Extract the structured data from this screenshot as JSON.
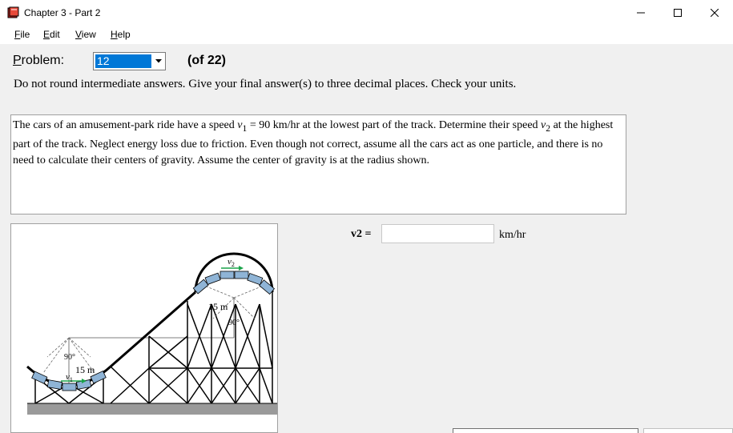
{
  "window": {
    "title": "Chapter 3 - Part 2",
    "controls": [
      "minimize",
      "maximize",
      "close"
    ]
  },
  "menu": {
    "file": {
      "accel": "F",
      "rest": "ile"
    },
    "edit": {
      "accel": "E",
      "rest": "dit"
    },
    "view": {
      "accel": "V",
      "rest": "iew"
    },
    "help": {
      "accel": "H",
      "rest": "elp"
    }
  },
  "problem": {
    "label_accel": "P",
    "label_rest": "roblem:",
    "selected": "12",
    "of_text": "(of 22)"
  },
  "instructions": "Do not round intermediate answers.  Give your final answer(s) to three decimal places.  Check your units.",
  "statement": {
    "part1": "The cars of an amusement-park ride have a speed ",
    "v1_sym": "v",
    "v1_sub": "1",
    "part2": " = 90 km/hr at the lowest part of the track. Determine their speed ",
    "v2_sym": "v",
    "v2_sub": "2",
    "part3": " at the highest part of the track. Neglect energy loss due to friction. Even though not correct, assume all the cars act as one particle, and there is no need to calculate their centers of gravity.  Assume the center of gravity is at the radius shown."
  },
  "figure": {
    "top_radius": "15 m",
    "top_angle": "90°",
    "bottom_radius": "15 m",
    "bottom_angle": "90°",
    "v1_label": "v",
    "v1_sub": "1",
    "v2_label": "v",
    "v2_sub": "2"
  },
  "answer": {
    "label": "v2 =",
    "value": "",
    "unit": "km/hr"
  },
  "colors": {
    "selection": "#0078d7",
    "arrow": "#1aa34a"
  }
}
